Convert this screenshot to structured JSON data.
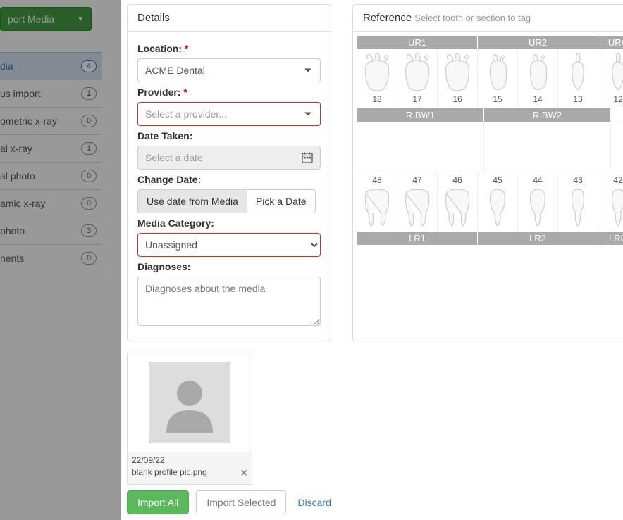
{
  "sidebar": {
    "import_btn": "port Media",
    "items": [
      {
        "label": "dia",
        "count": 4,
        "active": true
      },
      {
        "label": "us import",
        "count": 1
      },
      {
        "label": "ometric x-ray",
        "count": 0
      },
      {
        "label": "al x-ray",
        "count": 1
      },
      {
        "label": "al photo",
        "count": 0
      },
      {
        "label": "amic x-ray",
        "count": 0
      },
      {
        "label": "photo",
        "count": 3
      },
      {
        "label": "nents",
        "count": 0
      }
    ]
  },
  "details": {
    "heading": "Details",
    "location_label": "Location:",
    "location_value": "ACME Dental",
    "provider_label": "Provider:",
    "provider_placeholder": "Select a provider...",
    "date_taken_label": "Date Taken:",
    "date_placeholder": "Select a date",
    "change_date_label": "Change Date:",
    "change_date_opts": [
      "Use date from Media",
      "Pick a Date"
    ],
    "category_label": "Media Category:",
    "category_value": "Unassigned",
    "diagnoses_label": "Diagnoses:",
    "diagnoses_placeholder": "Diagnoses about the media"
  },
  "reference": {
    "heading": "Reference",
    "subheading": "Select tooth or section to tag",
    "upper_heads": [
      "UR1",
      "UR2",
      "URC"
    ],
    "upper_nums": [
      "18",
      "17",
      "16",
      "15",
      "14",
      "13",
      "12"
    ],
    "bw_heads": [
      "R.BW1",
      "R.BW2"
    ],
    "lower_nums": [
      "48",
      "47",
      "46",
      "45",
      "44",
      "43",
      "42"
    ],
    "lower_heads": [
      "LR1",
      "LR2",
      "LRC"
    ]
  },
  "media": {
    "date": "22/09/22",
    "filename": "blank profile pic.png"
  },
  "actions": {
    "import_all": "Import All",
    "import_selected": "Import Selected",
    "discard": "Discard"
  }
}
